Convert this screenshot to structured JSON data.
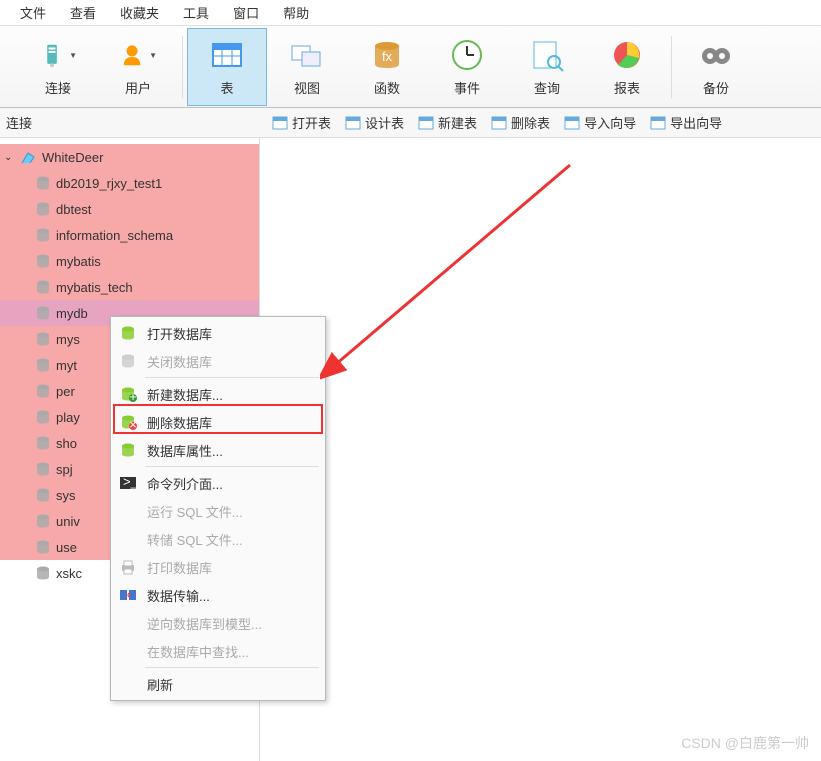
{
  "menu": {
    "items": [
      "文件",
      "查看",
      "收藏夹",
      "工具",
      "窗口",
      "帮助"
    ]
  },
  "toolbar": {
    "items": [
      {
        "label": "连接",
        "icon": "server"
      },
      {
        "label": "用户",
        "icon": "user"
      },
      {
        "label": "表",
        "icon": "table",
        "active": true
      },
      {
        "label": "视图",
        "icon": "view"
      },
      {
        "label": "函数",
        "icon": "function"
      },
      {
        "label": "事件",
        "icon": "event"
      },
      {
        "label": "查询",
        "icon": "query"
      },
      {
        "label": "报表",
        "icon": "report"
      },
      {
        "label": "备份",
        "icon": "backup"
      }
    ]
  },
  "subtoolbar": {
    "left": "连接",
    "items": [
      "打开表",
      "设计表",
      "新建表",
      "删除表",
      "导入向导",
      "导出向导"
    ]
  },
  "tree": {
    "root": {
      "label": "WhiteDeer"
    },
    "databases": [
      "db2019_rjxy_test1",
      "dbtest",
      "information_schema",
      "mybatis",
      "mybatis_tech",
      "mydb",
      "mys",
      "myt",
      "per",
      "play",
      "sho",
      "spj",
      "sys",
      "univ",
      "use",
      "xskc"
    ],
    "cuts": [
      "mydb",
      "mys",
      "myt",
      "per",
      "play",
      "sho",
      "spj",
      "sys",
      "univ",
      "use",
      "xskc"
    ],
    "selected": "mydb",
    "normal": "xskc"
  },
  "context_menu": {
    "items": [
      {
        "label": "打开数据库",
        "icon": "db-open"
      },
      {
        "label": "关闭数据库",
        "icon": "db-close",
        "disabled": true
      },
      {
        "sep": true
      },
      {
        "label": "新建数据库...",
        "icon": "db-new"
      },
      {
        "label": "删除数据库",
        "icon": "db-del",
        "highlighted": true
      },
      {
        "label": "数据库属性...",
        "icon": "db-prop"
      },
      {
        "sep": true
      },
      {
        "label": "命令列介面...",
        "icon": "cmd"
      },
      {
        "label": "运行 SQL 文件...",
        "disabled": true
      },
      {
        "label": "转储 SQL 文件...",
        "disabled": true
      },
      {
        "label": "打印数据库",
        "icon": "print",
        "disabled": true
      },
      {
        "label": "数据传输...",
        "icon": "transfer"
      },
      {
        "label": "逆向数据库到模型...",
        "disabled": true
      },
      {
        "label": "在数据库中查找...",
        "disabled": true
      },
      {
        "sep": true
      },
      {
        "label": "刷新"
      }
    ]
  },
  "watermark": "CSDN @白鹿第一帅"
}
